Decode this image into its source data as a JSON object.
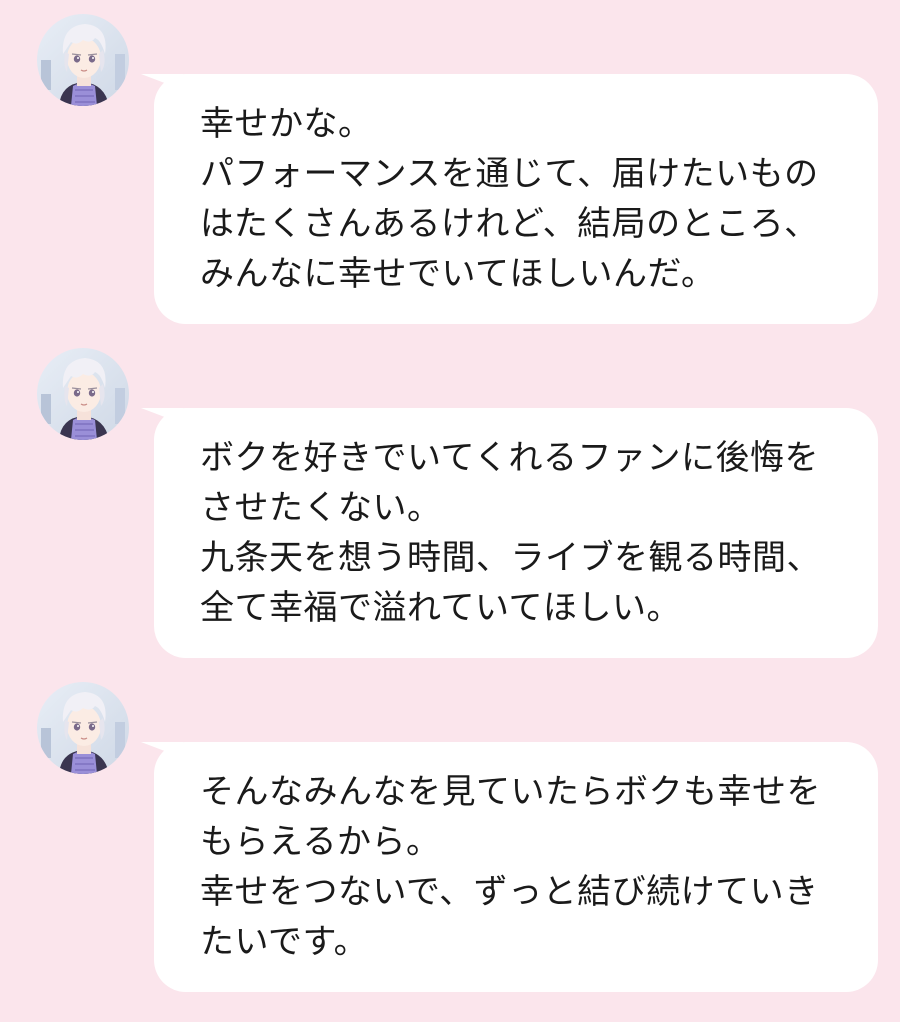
{
  "theme": {
    "background": "#fbe5ec",
    "bubble": "#ffffff",
    "text": "#1a1a1a"
  },
  "avatar_icon": "character-portrait-icon",
  "messages": [
    {
      "lines": [
        "幸せかな。",
        "パフォーマンスを通じて、届けたいもの",
        "はたくさんあるけれど、結局のところ、",
        "みんなに幸せでいてほしいんだ。"
      ]
    },
    {
      "lines": [
        "ボクを好きでいてくれるファンに後悔を",
        "させたくない。",
        "九条天を想う時間、ライブを観る時間、",
        "全て幸福で溢れていてほしい。"
      ]
    },
    {
      "lines": [
        "そんなみんなを見ていたらボクも幸せを",
        "もらえるから。",
        "幸せをつないで、ずっと結び続けていき",
        "たいです。"
      ]
    }
  ]
}
